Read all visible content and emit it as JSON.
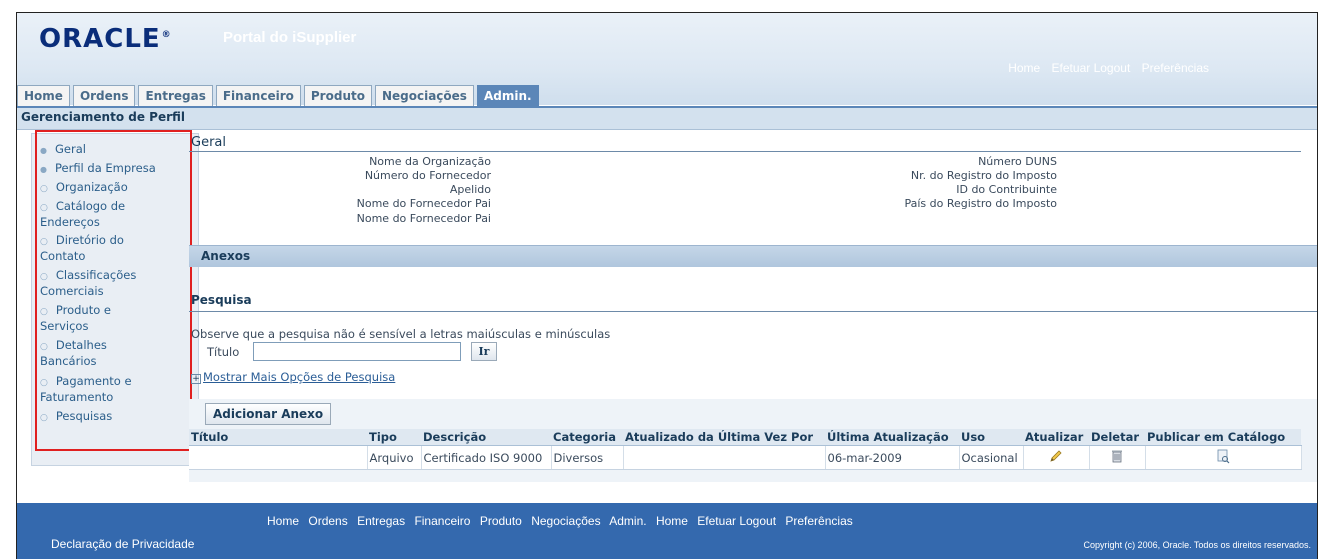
{
  "header": {
    "logo": "ORACLE",
    "logo_mark": "®",
    "portal_title": "Portal do iSupplier",
    "links": [
      "Home",
      "Efetuar Logout",
      "Preferências"
    ]
  },
  "tabs": [
    "Home",
    "Ordens",
    "Entregas",
    "Financeiro",
    "Produto",
    "Negociações",
    "Admin."
  ],
  "active_tab": "Admin.",
  "subbar_title": "Gerenciamento de Perfil",
  "sidebar": {
    "items": [
      {
        "label": "Geral"
      },
      {
        "label": "Perfil da Empresa"
      },
      {
        "label": "Organização"
      },
      {
        "label_line1": "Catálogo de",
        "label_line2": "Endereços"
      },
      {
        "label_line1": "Diretório do",
        "label_line2": "Contato"
      },
      {
        "label_line1": "Classificações",
        "label_line2": "Comerciais"
      },
      {
        "label_line1": "Produto e",
        "label_line2": "Serviços"
      },
      {
        "label_line1": "Detalhes",
        "label_line2": "Bancários"
      },
      {
        "label_line1": "Pagamento e",
        "label_line2": "Faturamento"
      },
      {
        "label": "Pesquisas"
      }
    ]
  },
  "geral": {
    "title": "Geral",
    "left_labels": [
      "Nome da Organização",
      "Número do Fornecedor",
      "Apelido",
      "Nome do Fornecedor Pai",
      "Nome do Fornecedor Pai"
    ],
    "right_labels": [
      "Número DUNS",
      "Nr. do Registro do Imposto",
      "ID do Contribuinte",
      "País do Registro do Imposto"
    ]
  },
  "anexos": {
    "title": "Anexos",
    "search_title": "Pesquisa",
    "note": "Observe que a pesquisa não é sensível a letras maiúsculas e minúsculas",
    "titulo_label": "Título",
    "titulo_value": "",
    "go_label": "Ir",
    "more_options": "Mostrar Mais Opções de Pesquisa",
    "add_button": "Adicionar Anexo",
    "columns": [
      "Título",
      "Tipo",
      "Descrição",
      "Categoria",
      "Atualizado da Última Vez Por",
      "Última Atualização",
      "Uso",
      "Atualizar",
      "Deletar",
      "Publicar em Catálogo"
    ],
    "row": {
      "titulo": "",
      "tipo": "Arquivo",
      "descricao": "Certificado ISO 9000",
      "categoria": "Diversos",
      "atualizado_por": "",
      "ultima_atualizacao": "06-mar-2009",
      "uso": "Ocasional",
      "atualizar_icon": "pencil-icon",
      "deletar_icon": "trash-icon",
      "publicar_icon": "publish-catalog-icon"
    }
  },
  "footer": {
    "links": [
      "Home",
      "Ordens",
      "Entregas",
      "Financeiro",
      "Produto",
      "Negociações",
      "Admin.",
      "Home",
      "Efetuar Logout",
      "Preferências"
    ],
    "privacy": "Declaração de Privacidade",
    "copyright": "Copyright (c) 2006, Oracle. Todos os direitos reservados."
  },
  "colors": {
    "brand_blue": "#0a2d7a",
    "tab_active": "#5b86b8",
    "footer_bg": "#3469ae",
    "highlight_outline": "#e02020"
  }
}
